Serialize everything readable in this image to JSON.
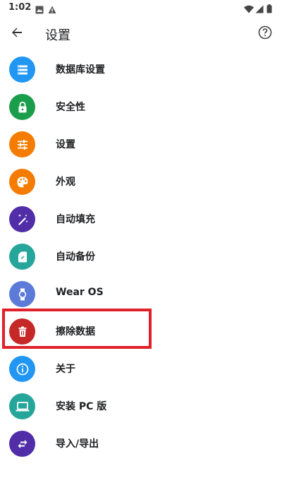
{
  "status_bar": {
    "time": "1:02",
    "left_icons": [
      "image-notification-icon",
      "alert-notification-icon"
    ],
    "right_icons": [
      "wifi-icon",
      "cell-signal-icon",
      "battery-icon"
    ]
  },
  "app_bar": {
    "title": "设置",
    "back_icon": "arrow-back-icon",
    "help_icon": "help-circle-icon"
  },
  "menu": {
    "items": [
      {
        "label": "数据库设置",
        "icon": "storage-list-icon",
        "color": "#2196f3"
      },
      {
        "label": "安全性",
        "icon": "lock-icon",
        "color": "#1b9e4b"
      },
      {
        "label": "设置",
        "icon": "tune-sliders-icon",
        "color": "#f57c00"
      },
      {
        "label": "外观",
        "icon": "palette-icon",
        "color": "#f57c00"
      },
      {
        "label": "自动填充",
        "icon": "magic-wand-icon",
        "color": "#512da8"
      },
      {
        "label": "自动备份",
        "icon": "sd-card-icon",
        "color": "#26a69a"
      },
      {
        "label": "Wear OS",
        "icon": "smartwatch-icon",
        "color": "#5c7bd9"
      },
      {
        "label": "擦除数据",
        "icon": "trash-icon",
        "color": "#c62828"
      },
      {
        "label": "关于",
        "icon": "info-icon",
        "color": "#2196f3"
      },
      {
        "label": "安装 PC 版",
        "icon": "laptop-icon",
        "color": "#26a69a"
      },
      {
        "label": "导入/导出",
        "icon": "import-export-arrows-icon",
        "color": "#512da8"
      }
    ]
  },
  "highlight": {
    "target": "擦除数据",
    "color": "#e0202a"
  }
}
